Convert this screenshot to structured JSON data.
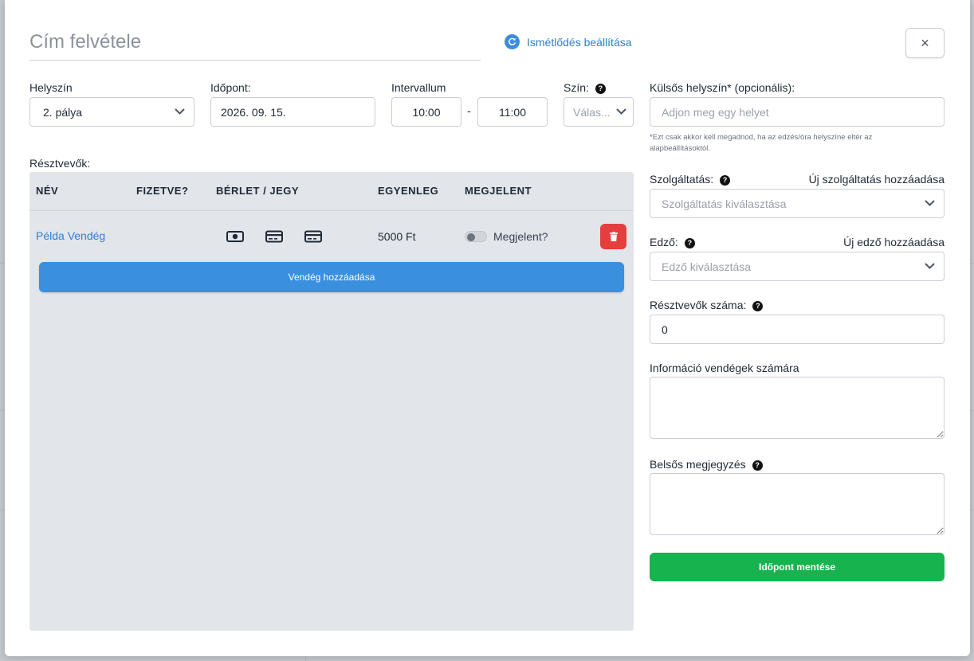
{
  "modal": {
    "title_placeholder": "Cím felvétele",
    "repeat_label": "Ismétlődés beállítása",
    "close_label": "×"
  },
  "form": {
    "location": {
      "label": "Helyszín",
      "value": "2. pálya"
    },
    "date": {
      "label": "Időpont:",
      "value": "2026. 09. 15."
    },
    "interval": {
      "label": "Intervallum",
      "start": "10:00",
      "separator": "-",
      "end": "11:00"
    },
    "color": {
      "label": "Szín:",
      "placeholder": "Válas..."
    },
    "external_location": {
      "label": "Külsős helyszín* (opcionális):",
      "placeholder": "Adjon meg egy helyet",
      "hint": "*Ezt csak akkor kell megadnod, ha az edzés/óra helyszíne eltér az alapbeállításoktól."
    },
    "service": {
      "label": "Szolgáltatás:",
      "add_link": "Új szolgáltatás hozzáadása",
      "placeholder": "Szolgáltatás kiválasztása"
    },
    "trainer": {
      "label": "Edző:",
      "add_link": "Új edző hozzáadása",
      "placeholder": "Edző kiválasztása"
    },
    "participant_count": {
      "label": "Résztvevők száma:",
      "value": "0"
    },
    "guest_info": {
      "label": "Információ vendégek számára",
      "value": ""
    },
    "internal_note": {
      "label": "Belsős megjegyzés",
      "value": ""
    },
    "save_label": "Időpont mentése"
  },
  "participants": {
    "label": "Résztvevők:",
    "columns": [
      "NÉV",
      "FIZETVE?",
      "BÉRLET / JEGY",
      "EGYENLEG",
      "MEGJELENT"
    ],
    "rows": [
      {
        "name": "Példa Vendég",
        "balance": "5000 Ft",
        "attended_label": "Megjelent?",
        "attended": false
      }
    ],
    "add_guest_label": "Vendég hozzáadása"
  },
  "icons": {
    "repeat": "refresh-icon",
    "close": "close-icon",
    "help": "question-circle-icon",
    "cash": "cash-icon",
    "card": "credit-card-icon",
    "delete": "trash-icon",
    "chevron": "chevron-down-icon"
  },
  "colors": {
    "accent": "#3b8fdf",
    "link": "#2f7fd1",
    "danger": "#e53e3e",
    "success": "#16b34f",
    "panel": "#e2e5ea"
  }
}
